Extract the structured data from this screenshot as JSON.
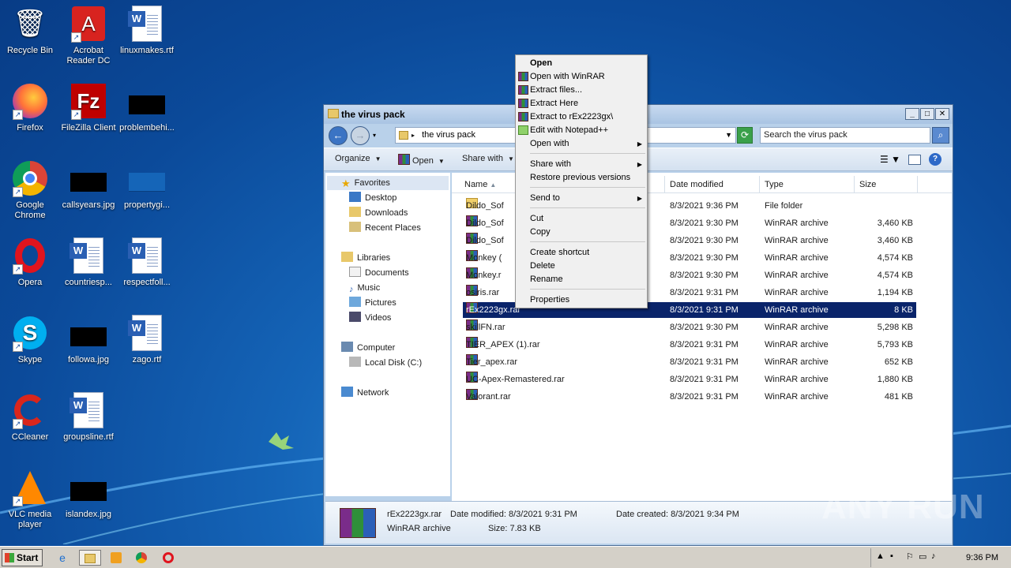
{
  "desktop": {
    "icons": [
      {
        "label": "Recycle Bin",
        "icon": "recycle-bin-icon"
      },
      {
        "label": "Acrobat Reader DC",
        "icon": "acrobat-icon"
      },
      {
        "label": "linuxmakes.rtf",
        "icon": "word-doc-icon"
      },
      {
        "label": "Firefox",
        "icon": "firefox-icon"
      },
      {
        "label": "FileZilla Client",
        "icon": "filezilla-icon"
      },
      {
        "label": "problembehi...",
        "icon": "image-thumbnail-icon"
      },
      {
        "label": "Google Chrome",
        "icon": "chrome-icon"
      },
      {
        "label": "callsyears.jpg",
        "icon": "image-thumbnail-icon"
      },
      {
        "label": "propertygi...",
        "icon": "image-thumbnail-icon"
      },
      {
        "label": "Opera",
        "icon": "opera-icon"
      },
      {
        "label": "countriesp...",
        "icon": "word-doc-icon"
      },
      {
        "label": "respectfoll...",
        "icon": "word-doc-icon"
      },
      {
        "label": "Skype",
        "icon": "skype-icon"
      },
      {
        "label": "followa.jpg",
        "icon": "image-thumbnail-icon"
      },
      {
        "label": "zago.rtf",
        "icon": "word-doc-icon"
      },
      {
        "label": "CCleaner",
        "icon": "ccleaner-icon"
      },
      {
        "label": "groupsline.rtf",
        "icon": "word-doc-icon"
      },
      {
        "label": "VLC media player",
        "icon": "vlc-icon"
      },
      {
        "label": "islandex.jpg",
        "icon": "image-thumbnail-icon"
      }
    ]
  },
  "window": {
    "title": "the virus pack",
    "address": "the virus pack",
    "search_placeholder": "Search the virus pack",
    "toolbar": {
      "organize": "Organize",
      "open": "Open",
      "share_with": "Share with"
    },
    "nav": {
      "favorites": "Favorites",
      "desktop": "Desktop",
      "downloads": "Downloads",
      "recent_places": "Recent Places",
      "libraries": "Libraries",
      "documents": "Documents",
      "music": "Music",
      "pictures": "Pictures",
      "videos": "Videos",
      "computer": "Computer",
      "local_disk": "Local Disk (C:)",
      "network": "Network"
    },
    "columns": {
      "name": "Name",
      "date_modified": "Date modified",
      "type": "Type",
      "size": "Size"
    },
    "files": [
      {
        "name": "Dildo_Sof",
        "date": "8/3/2021 9:36 PM",
        "type": "File folder",
        "size": "",
        "kind": "folder"
      },
      {
        "name": "Dildo_Sof",
        "date": "8/3/2021 9:30 PM",
        "type": "WinRAR archive",
        "size": "3,460 KB",
        "kind": "rar"
      },
      {
        "name": "Dildo_Sof",
        "date": "8/3/2021 9:30 PM",
        "type": "WinRAR archive",
        "size": "3,460 KB",
        "kind": "rar"
      },
      {
        "name": "Monkey (",
        "date": "8/3/2021 9:30 PM",
        "type": "WinRAR archive",
        "size": "4,574 KB",
        "kind": "rar"
      },
      {
        "name": "Monkey.r",
        "date": "8/3/2021 9:30 PM",
        "type": "WinRAR archive",
        "size": "4,574 KB",
        "kind": "rar"
      },
      {
        "name": "osiris.rar",
        "date": "8/3/2021 9:31 PM",
        "type": "WinRAR archive",
        "size": "1,194 KB",
        "kind": "rar"
      },
      {
        "name": "rEx2223gx.rar",
        "date": "8/3/2021 9:31 PM",
        "type": "WinRAR archive",
        "size": "8 KB",
        "kind": "rar",
        "selected": true
      },
      {
        "name": "skillFN.rar",
        "date": "8/3/2021 9:30 PM",
        "type": "WinRAR archive",
        "size": "5,298 KB",
        "kind": "rar"
      },
      {
        "name": "TIER_APEX (1).rar",
        "date": "8/3/2021 9:31 PM",
        "type": "WinRAR archive",
        "size": "5,793 KB",
        "kind": "rar"
      },
      {
        "name": "Tier_apex.rar",
        "date": "8/3/2021 9:31 PM",
        "type": "WinRAR archive",
        "size": "652 KB",
        "kind": "rar"
      },
      {
        "name": "UC-Apex-Remastered.rar",
        "date": "8/3/2021 9:31 PM",
        "type": "WinRAR archive",
        "size": "1,880 KB",
        "kind": "rar"
      },
      {
        "name": "Valorant.rar",
        "date": "8/3/2021 9:31 PM",
        "type": "WinRAR archive",
        "size": "481 KB",
        "kind": "rar"
      }
    ],
    "details": {
      "name": "rEx2223gx.rar",
      "type": "WinRAR archive",
      "modified": "Date modified: 8/3/2021 9:31 PM",
      "created": "Date created: 8/3/2021 9:34 PM",
      "size": "Size: 7.83 KB"
    }
  },
  "context_menu": {
    "items": [
      {
        "label": "Open"
      },
      {
        "label": "Open with WinRAR"
      },
      {
        "label": "Extract files..."
      },
      {
        "label": "Extract Here"
      },
      {
        "label": "Extract to rEx2223gx\\"
      },
      {
        "label": "Edit with Notepad++"
      },
      {
        "label": "Open with"
      },
      {
        "label": "Share with"
      },
      {
        "label": "Restore previous versions"
      },
      {
        "label": "Send to"
      },
      {
        "label": "Cut"
      },
      {
        "label": "Copy"
      },
      {
        "label": "Create shortcut"
      },
      {
        "label": "Delete"
      },
      {
        "label": "Rename"
      },
      {
        "label": "Properties"
      }
    ]
  },
  "watermark": "ANY RUN",
  "taskbar": {
    "start": "Start",
    "clock": "9:36 PM"
  },
  "colors": {
    "selection": "#0a246a",
    "desktop": "#1565b8"
  }
}
